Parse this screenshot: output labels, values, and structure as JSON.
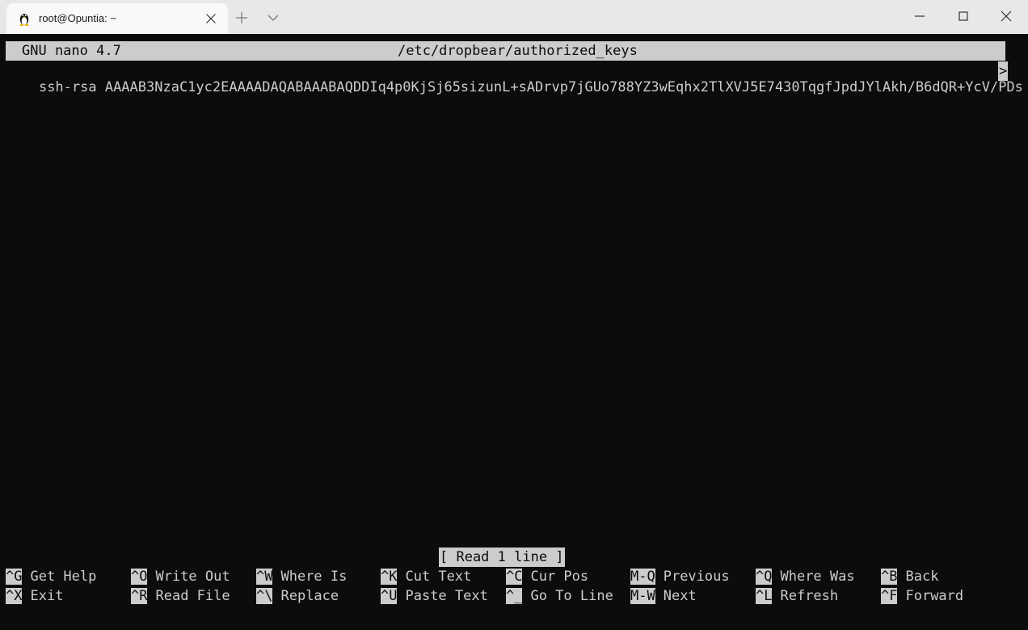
{
  "window": {
    "tab_title": "root@Opuntia: ~",
    "icons": {
      "tab": "linux-penguin-icon",
      "tab_close": "close-icon",
      "new_tab": "plus-icon",
      "dropdown": "chevron-down-icon",
      "minimize": "minimize-icon",
      "maximize": "maximize-icon",
      "close": "close-icon"
    }
  },
  "nano": {
    "version": "GNU nano 4.7",
    "filename": "/etc/dropbear/authorized_keys",
    "content_line": "ssh-rsa AAAAB3NzaC1yc2EAAAADAQABAAABAQDDIq4p0KjSj65sizunL+sADrvp7jGUo788YZ3wEqhx2TlXVJ5E7430TqgfJpdJYlAkh/B6dQR+YcV/PDs",
    "overflow_marker": ">",
    "status": "[ Read 1 line ]",
    "shortcuts_row1": [
      {
        "key": "^G",
        "label": "Get Help"
      },
      {
        "key": "^O",
        "label": "Write Out"
      },
      {
        "key": "^W",
        "label": "Where Is"
      },
      {
        "key": "^K",
        "label": "Cut Text"
      },
      {
        "key": "^C",
        "label": "Cur Pos"
      },
      {
        "key": "M-Q",
        "label": "Previous"
      },
      {
        "key": "^Q",
        "label": "Where Was"
      },
      {
        "key": "^B",
        "label": "Back"
      }
    ],
    "shortcuts_row2": [
      {
        "key": "^X",
        "label": "Exit"
      },
      {
        "key": "^R",
        "label": "Read File"
      },
      {
        "key": "^\\",
        "label": "Replace"
      },
      {
        "key": "^U",
        "label": "Paste Text"
      },
      {
        "key": "^_",
        "label": "Go To Line"
      },
      {
        "key": "M-W",
        "label": "Next"
      },
      {
        "key": "^L",
        "label": "Refresh"
      },
      {
        "key": "^F",
        "label": "Forward"
      }
    ]
  },
  "colors": {
    "terminal_bg": "#0c0c0c",
    "terminal_fg": "#cccccc",
    "titlebar_bg": "#e8e8e8",
    "tab_bg": "#f9f9f9"
  }
}
